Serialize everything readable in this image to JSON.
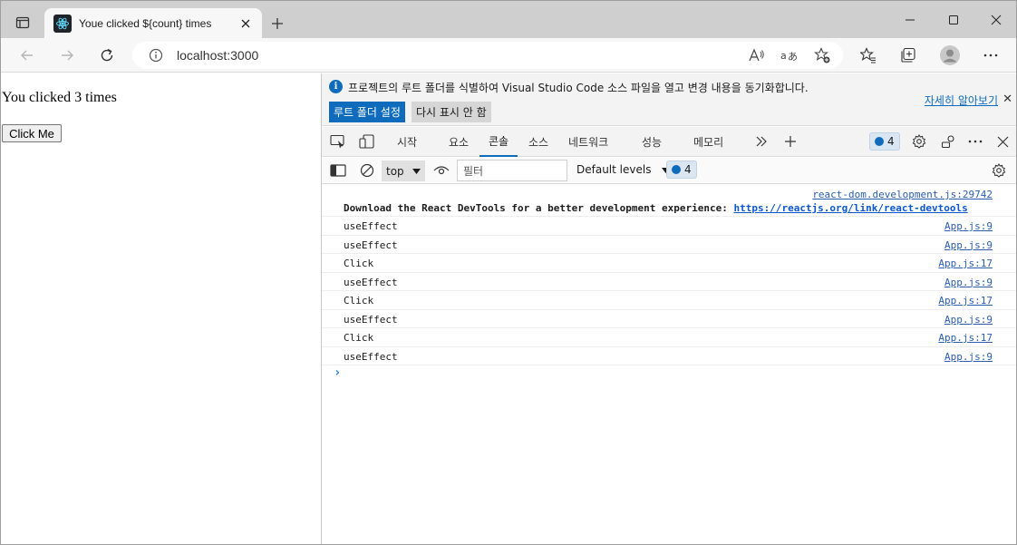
{
  "browser": {
    "tab_title": "Youe clicked ${count} times",
    "url": "localhost:3000"
  },
  "page": {
    "heading": "You clicked 3 times",
    "button_label": "Click Me"
  },
  "devtools": {
    "infobar": {
      "message": "프로젝트의 루트 폴더를 식별하여 Visual Studio Code 소스 파일을 열고 변경 내용을 동기화합니다.",
      "learn_more": "자세히 알아보기",
      "primary_button": "루트 폴더 설정",
      "secondary_button": "다시 표시 안 함"
    },
    "tabs": [
      {
        "label": "시작"
      },
      {
        "label": "요소"
      },
      {
        "label": "콘솔"
      },
      {
        "label": "소스"
      },
      {
        "label": "네트워크"
      },
      {
        "label": "성능"
      },
      {
        "label": "메모리"
      }
    ],
    "issues_count": "4",
    "console_bar": {
      "context": "top",
      "filter_placeholder": "필터",
      "levels": "Default levels",
      "messages_count": "4"
    },
    "log": [
      {
        "text": "Download the React DevTools for a better development experience: ",
        "link": "https://reactjs.org/link/react-devtools",
        "source": "react-dom.development.js:29742"
      },
      {
        "text": "useEffect",
        "source": "App.js:9"
      },
      {
        "text": "useEffect",
        "source": "App.js:9"
      },
      {
        "text": "Click",
        "source": "App.js:17"
      },
      {
        "text": "useEffect",
        "source": "App.js:9"
      },
      {
        "text": "Click",
        "source": "App.js:17"
      },
      {
        "text": "useEffect",
        "source": "App.js:9"
      },
      {
        "text": "Click",
        "source": "App.js:17"
      },
      {
        "text": "useEffect",
        "source": "App.js:9"
      }
    ],
    "prompt_symbol": "›"
  }
}
